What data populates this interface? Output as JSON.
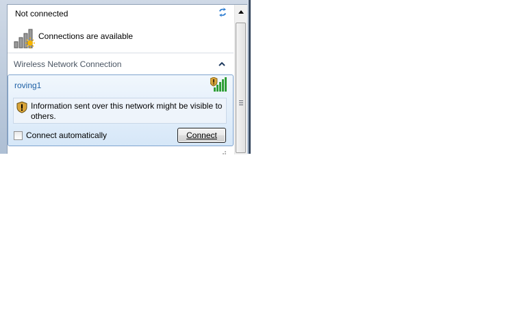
{
  "flyout": {
    "title": "Not connected",
    "status_text": "Connections are available",
    "section_label": "Wireless Network Connection",
    "network": {
      "name": "roving1",
      "warning": "Information sent over this network might be visible to others.",
      "auto_connect_label": "Connect automatically",
      "auto_connect_checked": false,
      "connect_label": "Connect"
    }
  },
  "icons": {
    "refresh": "refresh-icon",
    "connection_status": "network-status-icon",
    "collapse": "chevron-up-icon",
    "signal": "wireless-signal-icon",
    "shield": "security-shield-icon"
  },
  "colors": {
    "network_name": "#1c5fa4",
    "signal_bars": "#2f9e36",
    "shield": "#d8a43a",
    "selection_border": "#7da2ce"
  }
}
